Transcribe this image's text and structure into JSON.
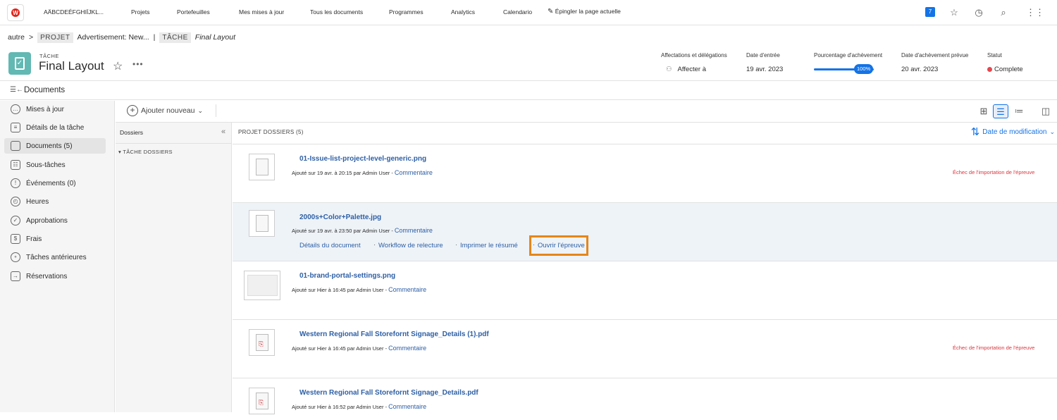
{
  "topnav": {
    "org": "AÄBCDEÉFGHIÏJKL...",
    "items": [
      "Projets",
      "Portefeuilles",
      "Mes mises à jour",
      "Tous les documents",
      "Programmes",
      "Analytics",
      "Calendario"
    ],
    "pin_label": "Épingler la page actuelle",
    "notification_count": "7",
    "accent": "#1473e6"
  },
  "breadcrumb": {
    "root": "autre",
    "sep": ">",
    "project_chip": "PROJET",
    "project_name": "Advertisement: New...",
    "divider": "|",
    "task_chip": "TÂCHE",
    "task_name": "Final Layout"
  },
  "header": {
    "type": "TÂCHE",
    "title": "Final Layout",
    "more": "•••",
    "assign_label": "Affectations et délégations",
    "assign_value": "Affecter à",
    "entry_label": "Date d'entrée",
    "entry_value": "19 avr. 2023",
    "progress_label": "Pourcentage d'achèvement",
    "progress_value": "100%",
    "progress_fraction": 1.0,
    "planned_label": "Date d'achèvement prévue",
    "planned_value": "20 avr. 2023",
    "status_label": "Statut",
    "status_value": "Complete",
    "status_color": "#e34850"
  },
  "docsbar": {
    "title": "Documents"
  },
  "leftnav": {
    "items": [
      {
        "label": "Mises à jour",
        "icon": "chat-icon"
      },
      {
        "label": "Détails de la tâche",
        "icon": "details-icon"
      },
      {
        "label": "Documents (5)",
        "icon": "document-icon"
      },
      {
        "label": "Sous-tâches",
        "icon": "subtasks-icon"
      },
      {
        "label": "Événements (0)",
        "icon": "events-icon"
      },
      {
        "label": "Heures",
        "icon": "clock-icon"
      },
      {
        "label": "Approbations",
        "icon": "approval-icon"
      },
      {
        "label": "Frais",
        "icon": "money-icon"
      },
      {
        "label": "Tâches antérieures",
        "icon": "predecessor-icon"
      },
      {
        "label": "Réservations",
        "icon": "reservation-icon"
      }
    ]
  },
  "toolbar": {
    "add_new": "Ajouter nouveau"
  },
  "folders": {
    "header": "Dossiers",
    "item": "TÂCHE DOSSIERS"
  },
  "main": {
    "header": "PROJET DOSSIERS (5)",
    "sort_label": "Date de modification",
    "documents": [
      {
        "name": "01-Issue-list-project-level-generic.png",
        "meta": "Ajouté sur 19 avr. à 20:15 par Admin User",
        "link": "Commentaire",
        "error": "Échec de l'importation de l'épreuve"
      },
      {
        "name": "2000s+Color+Palette.jpg",
        "meta": "Ajouté sur 19 avr. à 23:50 par Admin User",
        "link": "Commentaire",
        "error": ""
      },
      {
        "name": "01-brand-portal-settings.png",
        "meta": "Ajouté sur Hier à 16:45 par Admin User",
        "link": "Commentaire",
        "error": ""
      },
      {
        "name": "Western Regional Fall Storefornt Signage_Details (1).pdf",
        "meta": "Ajouté sur Hier à 16:45 par Admin User",
        "link": "Commentaire",
        "error": "Échec de l'importation de l'épreuve"
      },
      {
        "name": "Western Regional Fall Storefornt Signage_Details.pdf",
        "meta": "Ajouté sur Hier à 16:52 par Admin User",
        "link": "Commentaire",
        "error": ""
      }
    ],
    "row_actions": [
      "Détails du document",
      "Workflow de relecture",
      "Imprimer le résumé",
      "Ouvrir l'épreuve"
    ]
  }
}
